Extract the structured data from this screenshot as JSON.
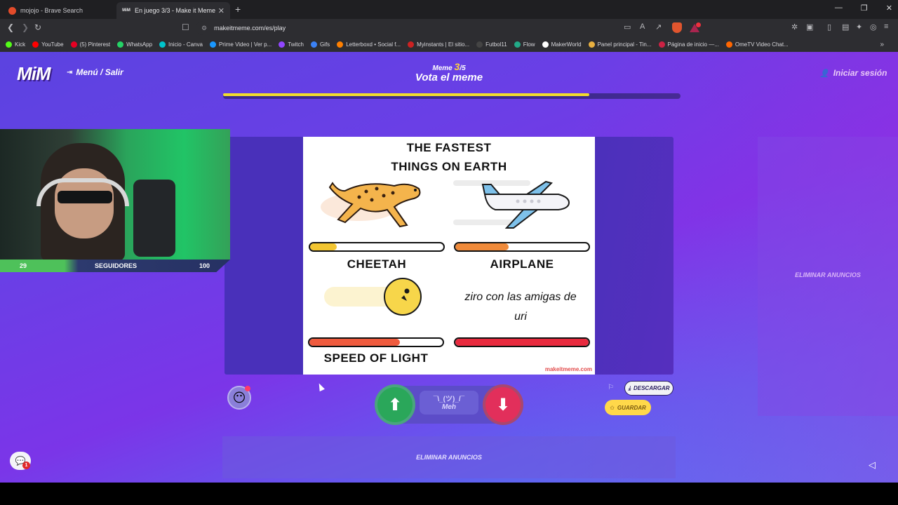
{
  "tabs": [
    {
      "title": "mojojo - Brave Search"
    },
    {
      "title": "En juego 3/3 - Make it Meme",
      "icon": "MiM"
    }
  ],
  "address": {
    "url": "makeitmeme.com/es/play"
  },
  "bookmarks": [
    {
      "label": "Kick",
      "color": "#53fc18"
    },
    {
      "label": "YouTube",
      "color": "#ff0000"
    },
    {
      "label": "(5) Pinterest",
      "color": "#e60023"
    },
    {
      "label": "WhatsApp",
      "color": "#25d366"
    },
    {
      "label": "Inicio - Canva",
      "color": "#00c4cc"
    },
    {
      "label": "Prime Video | Ver p...",
      "color": "#1a98ff"
    },
    {
      "label": "Twitch",
      "color": "#9146ff"
    },
    {
      "label": "Gifs",
      "color": "#3b82f6"
    },
    {
      "label": "Letterboxd • Social f...",
      "color": "#ff8000"
    },
    {
      "label": "Myinstants | El sitio...",
      "color": "#cc2222"
    },
    {
      "label": "Futbol11",
      "color": "#444444"
    },
    {
      "label": "Flow",
      "color": "#22aa88"
    },
    {
      "label": "MakerWorld",
      "color": "#ffffff"
    },
    {
      "label": "Panel principal - Tin...",
      "color": "#e8b040"
    },
    {
      "label": "Página de inicio —...",
      "color": "#cc2244"
    },
    {
      "label": "OmeTV Video Chat...",
      "color": "#ff6600"
    }
  ],
  "header": {
    "logo": "MiM",
    "menu_label": "Menú / Salir",
    "meme_prefix": "Meme",
    "meme_current": "3",
    "meme_total": "/5",
    "title": "Vota el meme",
    "login_label": "Iniciar sesión"
  },
  "round_progress": 0.8,
  "webcam": {
    "followers_current": "29",
    "followers_label": "SEGUIDORES",
    "followers_goal": "100"
  },
  "meme": {
    "title_line1": "THE FASTEST",
    "title_line2": "THINGS ON EARTH",
    "items": [
      {
        "label": "CHEETAH",
        "speed": 0.2,
        "color": "#f2c531"
      },
      {
        "label": "AIRPLANE",
        "speed": 0.4,
        "color": "#ef8a3a"
      },
      {
        "label": "SPEED OF LIGHT",
        "speed": 0.68,
        "color": "#ef5b3e"
      },
      {
        "label": "ziro con las amigas de uri",
        "speed": 1.0,
        "color": "#e82a3e"
      }
    ],
    "watermark": "makeitmeme.com"
  },
  "vote": {
    "meh_face": "¯\\_(ツ)_/¯",
    "meh_label": "Meh"
  },
  "actions": {
    "download_label": "DESCARGAR",
    "save_label": "GUARDAR"
  },
  "ads": {
    "side_label": "ELIMINAR ANUNCIOS",
    "bottom_label": "ELIMINAR ANUNCIOS"
  },
  "chat": {
    "badge": "1"
  }
}
